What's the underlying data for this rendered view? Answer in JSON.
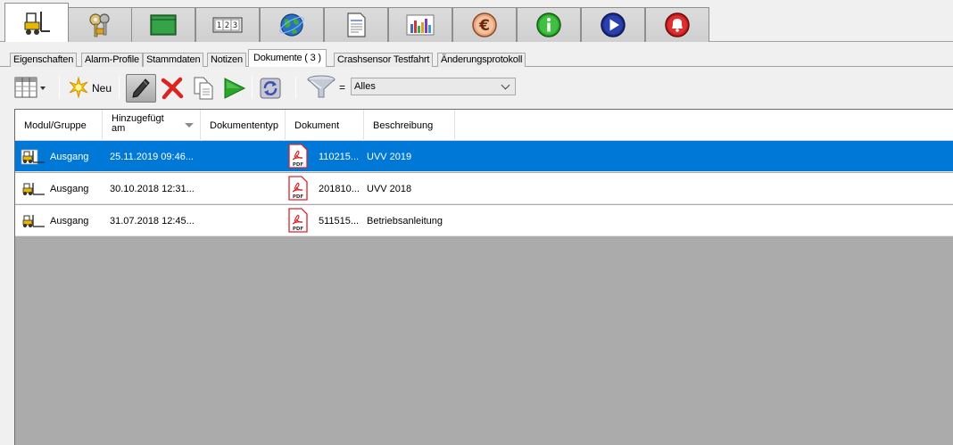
{
  "icon_tabs": [
    {
      "icon": "forklift-icon",
      "active": true
    },
    {
      "icon": "keys-icon"
    },
    {
      "icon": "green-book-icon"
    },
    {
      "icon": "counter-icon",
      "text": "123"
    },
    {
      "icon": "globe-icon"
    },
    {
      "icon": "document-icon"
    },
    {
      "icon": "bar-chart-icon"
    },
    {
      "icon": "euro-icon",
      "text": "€"
    },
    {
      "icon": "info-icon",
      "text": "i"
    },
    {
      "icon": "play-icon"
    },
    {
      "icon": "alarm-bell-icon"
    }
  ],
  "text_tabs": [
    {
      "label": "Eigenschaften"
    },
    {
      "label": "Alarm-Profile"
    },
    {
      "label": "Stammdaten"
    },
    {
      "label": "Notizen"
    },
    {
      "label": "Dokumente  ( 3 )",
      "active": true
    },
    {
      "label": "Crashsensor Testfahrt"
    },
    {
      "label": "Änderungsprotokoll"
    }
  ],
  "toolbar": {
    "new_label": "Neu",
    "filter_eq": "=",
    "filter_value": "Alles"
  },
  "grid": {
    "columns": [
      "Modul/Gruppe",
      "Hinzugefügt am",
      "Dokumententyp",
      "Dokument",
      "Beschreibung"
    ],
    "rows": [
      {
        "modul": "Ausgang",
        "added": "25.11.2019 09:46...",
        "doctype": "",
        "document": "110215...",
        "description": "UVV 2019",
        "selected": true
      },
      {
        "modul": "Ausgang",
        "added": "30.10.2018 12:31...",
        "doctype": "",
        "document": "201810...",
        "description": "UVV 2018"
      },
      {
        "modul": "Ausgang",
        "added": "31.07.2018 12:45...",
        "doctype": "",
        "document": "511515...",
        "description": "Betriebsanleitung"
      }
    ]
  },
  "colors": {
    "selection": "#0078d7",
    "grid_empty": "#ababab",
    "pdf_red": "#d9242a"
  }
}
